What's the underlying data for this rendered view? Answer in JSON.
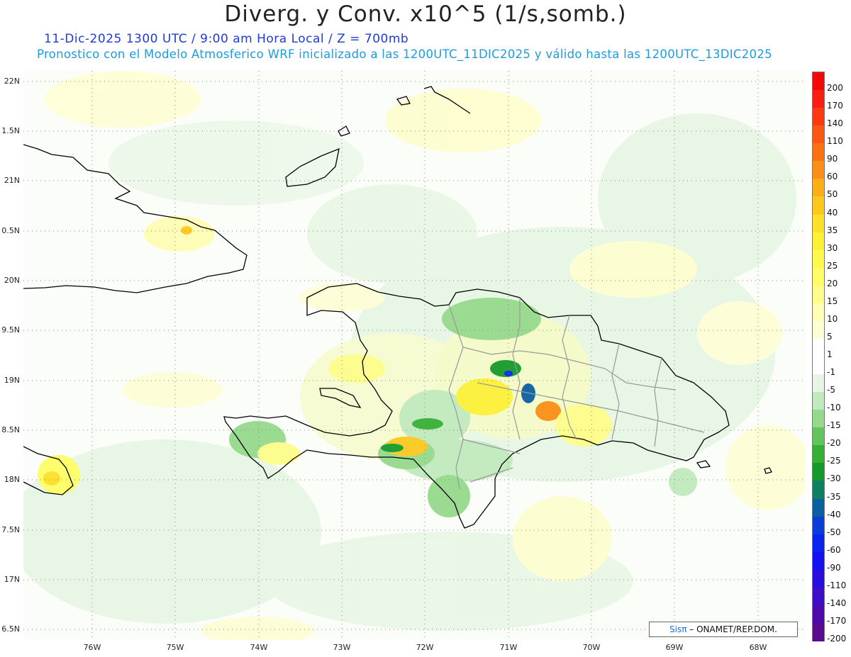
{
  "title": "Diverg. y Conv. x10^5 (1/s,somb.)",
  "subtitle_line1": "11-Dic-2025   1300 UTC / 9:00 am Hora Local / Z = 700mb",
  "subtitle_line2": "Pronostico con el Modelo Atmosferico WRF inicializado a las 1200UTC_11DIC2025 y válido hasta las  1200UTC_13DIC2025",
  "credit": {
    "logo": "Sisπ",
    "text": "– ONAMET/REP.DOM."
  },
  "lat_labels": [
    "22N",
    "1.5N",
    "21N",
    "0.5N",
    "20N",
    "9.5N",
    "19N",
    "8.5N",
    "18N",
    "7.5N",
    "17N",
    "6.5N"
  ],
  "lon_labels": [
    "76W",
    "75W",
    "74W",
    "73W",
    "72W",
    "71W",
    "70W",
    "69W",
    "68W"
  ],
  "colorbar": [
    {
      "label": "200",
      "color": "#f50808"
    },
    {
      "label": "170",
      "color": "#f81e10"
    },
    {
      "label": "140",
      "color": "#fb3a10"
    },
    {
      "label": "110",
      "color": "#fb5812"
    },
    {
      "label": "90",
      "color": "#fb7214"
    },
    {
      "label": "60",
      "color": "#fb8e16"
    },
    {
      "label": "50",
      "color": "#fcae1a"
    },
    {
      "label": "40",
      "color": "#fdc81e"
    },
    {
      "label": "35",
      "color": "#fde02a"
    },
    {
      "label": "30",
      "color": "#fdf038"
    },
    {
      "label": "25",
      "color": "#fef94a"
    },
    {
      "label": "20",
      "color": "#fefd66"
    },
    {
      "label": "15",
      "color": "#fefd8a"
    },
    {
      "label": "10",
      "color": "#fefeb4"
    },
    {
      "label": "5",
      "color": "#fefed6"
    },
    {
      "label": "1",
      "color": "#ffffff"
    },
    {
      "label": "-1",
      "color": "#ffffff"
    },
    {
      "label": "-5",
      "color": "#e6f5e4"
    },
    {
      "label": "-10",
      "color": "#c2e9bd"
    },
    {
      "label": "-15",
      "color": "#95d98c"
    },
    {
      "label": "-20",
      "color": "#62c55c"
    },
    {
      "label": "-25",
      "color": "#35b034"
    },
    {
      "label": "-30",
      "color": "#159a2a"
    },
    {
      "label": "-35",
      "color": "#0e7f60"
    },
    {
      "label": "-40",
      "color": "#0b5fa0"
    },
    {
      "label": "-50",
      "color": "#0a3cd6"
    },
    {
      "label": "-60",
      "color": "#0a24ee"
    },
    {
      "label": "-90",
      "color": "#1410f0"
    },
    {
      "label": "-110",
      "color": "#2a0cdc"
    },
    {
      "label": "-140",
      "color": "#3e0bc6"
    },
    {
      "label": "-170",
      "color": "#4d0aaa"
    },
    {
      "label": "-200",
      "color": "#5a0a8e"
    }
  ]
}
